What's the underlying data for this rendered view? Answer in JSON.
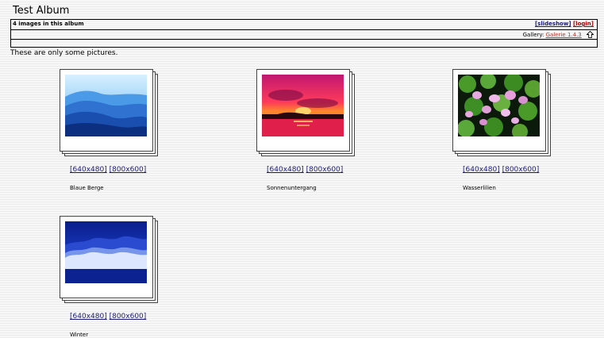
{
  "album": {
    "title": "Test Album",
    "count_text": "4 images in this album",
    "description": "These are only some pictures.",
    "links": {
      "slideshow": "[slideshow]",
      "login": "[login]"
    },
    "gallery_label": "Gallery:",
    "gallery_link": "Galerie 1.4.3"
  },
  "size_links": {
    "small": "[640x480]",
    "large": "[800x600]"
  },
  "photos": [
    {
      "caption": "Blaue Berge",
      "thumb_icon": "mountains-thumbnail"
    },
    {
      "caption": "Sonnenuntergang",
      "thumb_icon": "sunset-thumbnail"
    },
    {
      "caption": "Wasserlilien",
      "thumb_icon": "water-lilies-thumbnail"
    },
    {
      "caption": "Winter",
      "thumb_icon": "winter-trees-thumbnail"
    }
  ],
  "colors": {
    "link": "#1a1a7a",
    "login_link": "#aa0000",
    "gallery_link": "#c8322a"
  }
}
